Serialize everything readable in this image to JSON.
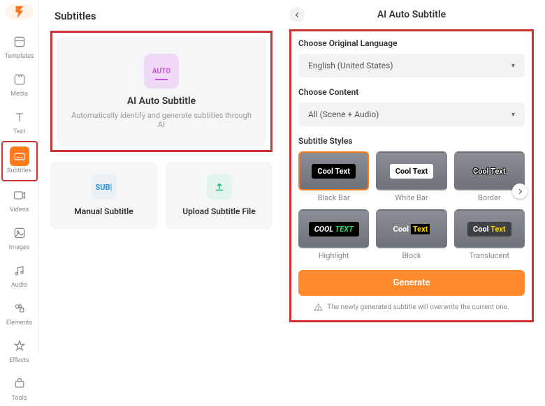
{
  "sidebar": {
    "items": [
      {
        "label": "Templates"
      },
      {
        "label": "Media"
      },
      {
        "label": "Text"
      },
      {
        "label": "Subtitles"
      },
      {
        "label": "Videos"
      },
      {
        "label": "Images"
      },
      {
        "label": "Audio"
      },
      {
        "label": "Elements"
      },
      {
        "label": "Effects"
      },
      {
        "label": "Tools"
      }
    ]
  },
  "left": {
    "title": "Subtitles",
    "auto": {
      "badge": "AUTO",
      "heading": "AI Auto Subtitle",
      "description": "Automatically identify and generate subtitles through AI"
    },
    "manual": {
      "heading": "Manual Subtitle",
      "icon_text": "SUB"
    },
    "upload": {
      "heading": "Upload Subtitle File"
    }
  },
  "right": {
    "title": "AI Auto Subtitle",
    "language_label": "Choose Original Language",
    "language_value": "English (United States)",
    "content_label": "Choose Content",
    "content_value": "All (Scene + Audio)",
    "styles_label": "Subtitle Styles",
    "styles": [
      {
        "name": "Black Bar",
        "preview": "Cool Text"
      },
      {
        "name": "White Bar",
        "preview": "Cool Text"
      },
      {
        "name": "Border",
        "preview": "Cool Text"
      },
      {
        "name": "Highlight",
        "preview_a": "COOL ",
        "preview_b": "TEXT"
      },
      {
        "name": "Block",
        "preview_a": "Cool ",
        "preview_b": "Text"
      },
      {
        "name": "Translucent",
        "preview_a": "Cool ",
        "preview_b": "Text"
      }
    ],
    "generate": "Generate",
    "warning": "The newly generated subtitle will overwrite the current one."
  }
}
